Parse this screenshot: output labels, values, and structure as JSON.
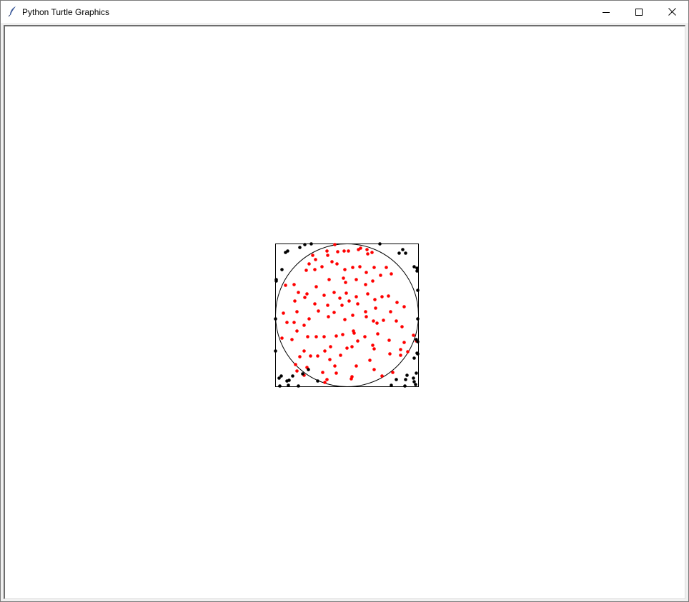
{
  "window": {
    "title": "Python Turtle Graphics",
    "icon": "feather-icon",
    "controls": {
      "minimize_icon": "minimize-icon",
      "maximize_icon": "maximize-icon",
      "close_icon": "close-icon"
    }
  },
  "colors": {
    "inside": "#ff0000",
    "outside": "#000000",
    "outline": "#000000",
    "background": "#ffffff"
  },
  "chart_data": {
    "type": "scatter",
    "xlim": [
      -1,
      1
    ],
    "ylim": [
      -1,
      1
    ],
    "square": {
      "xmin": -1,
      "xmax": 1,
      "ymin": -1,
      "ymax": 1
    },
    "circle": {
      "cx": 0,
      "cy": 0,
      "r": 1
    },
    "series": [
      {
        "color": "#ff0000",
        "points": [
          [
            -0.17,
            0.99
          ],
          [
            0.16,
            0.92
          ],
          [
            0.19,
            0.94
          ],
          [
            0.28,
            0.92
          ],
          [
            0.35,
            0.88
          ],
          [
            0.29,
            0.86
          ],
          [
            0.02,
            0.9
          ],
          [
            -0.04,
            0.9
          ],
          [
            -0.27,
            0.84
          ],
          [
            -0.48,
            0.84
          ],
          [
            -0.44,
            0.78
          ],
          [
            -0.28,
            0.9
          ],
          [
            -0.13,
            0.89
          ],
          [
            -0.21,
            0.75
          ],
          [
            -0.53,
            0.72
          ],
          [
            -0.57,
            0.63
          ],
          [
            -0.45,
            0.64
          ],
          [
            -0.35,
            0.68
          ],
          [
            -0.14,
            0.72
          ],
          [
            -0.03,
            0.64
          ],
          [
            0.08,
            0.67
          ],
          [
            0.18,
            0.68
          ],
          [
            0.27,
            0.6
          ],
          [
            0.38,
            0.67
          ],
          [
            0.55,
            0.67
          ],
          [
            0.62,
            0.58
          ],
          [
            0.47,
            0.56
          ],
          [
            0.36,
            0.48
          ],
          [
            0.26,
            0.43
          ],
          [
            0.13,
            0.5
          ],
          [
            -0.05,
            0.52
          ],
          [
            -0.25,
            0.5
          ],
          [
            -0.43,
            0.4
          ],
          [
            -0.74,
            0.43
          ],
          [
            -0.86,
            0.42
          ],
          [
            -0.68,
            0.32
          ],
          [
            -0.56,
            0.3
          ],
          [
            -0.32,
            0.28
          ],
          [
            -0.18,
            0.32
          ],
          [
            -0.1,
            0.24
          ],
          [
            -0.01,
            0.31
          ],
          [
            0.13,
            0.26
          ],
          [
            0.29,
            0.3
          ],
          [
            0.39,
            0.22
          ],
          [
            0.49,
            0.26
          ],
          [
            0.58,
            0.27
          ],
          [
            0.7,
            0.18
          ],
          [
            0.8,
            0.12
          ],
          [
            0.61,
            0.05
          ],
          [
            0.4,
            0.1
          ],
          [
            0.26,
            0.05
          ],
          [
            0.15,
            0.16
          ],
          [
            0.03,
            0.2
          ],
          [
            -0.07,
            0.14
          ],
          [
            -0.27,
            0.14
          ],
          [
            -0.45,
            0.16
          ],
          [
            -0.59,
            0.25
          ],
          [
            -0.73,
            0.2
          ],
          [
            -0.7,
            0.05
          ],
          [
            -0.89,
            0.03
          ],
          [
            -0.84,
            -0.1
          ],
          [
            -0.74,
            -0.1
          ],
          [
            -0.6,
            -0.14
          ],
          [
            -0.53,
            -0.05
          ],
          [
            -0.4,
            0.06
          ],
          [
            -0.26,
            -0.02
          ],
          [
            -0.18,
            0.04
          ],
          [
            -0.03,
            -0.06
          ],
          [
            0.08,
            0.0
          ],
          [
            0.27,
            -0.02
          ],
          [
            0.37,
            -0.08
          ],
          [
            0.51,
            -0.07
          ],
          [
            0.69,
            -0.08
          ],
          [
            0.77,
            -0.16
          ],
          [
            0.93,
            -0.28
          ],
          [
            0.97,
            -0.36
          ],
          [
            0.8,
            -0.38
          ],
          [
            0.75,
            -0.48
          ],
          [
            0.59,
            -0.35
          ],
          [
            0.43,
            -0.26
          ],
          [
            0.36,
            -0.42
          ],
          [
            0.25,
            -0.3
          ],
          [
            0.1,
            -0.25
          ],
          [
            -0.06,
            -0.27
          ],
          [
            -0.15,
            -0.29
          ],
          [
            -0.32,
            -0.3
          ],
          [
            -0.43,
            -0.3
          ],
          [
            -0.55,
            -0.3
          ],
          [
            -0.7,
            -0.22
          ],
          [
            -0.77,
            -0.34
          ],
          [
            -0.91,
            -0.32
          ],
          [
            -0.6,
            -0.5
          ],
          [
            -0.51,
            -0.57
          ],
          [
            -0.66,
            -0.58
          ],
          [
            -0.72,
            -0.69
          ],
          [
            -0.41,
            -0.57
          ],
          [
            -0.31,
            -0.5
          ],
          [
            -0.24,
            -0.62
          ],
          [
            -0.09,
            -0.56
          ],
          [
            0.0,
            -0.46
          ],
          [
            0.07,
            -0.44
          ],
          [
            0.15,
            -0.36
          ],
          [
            0.09,
            -0.22
          ],
          [
            0.38,
            -0.47
          ],
          [
            0.6,
            -0.54
          ],
          [
            0.75,
            -0.56
          ],
          [
            0.85,
            -0.51
          ],
          [
            0.64,
            -0.8
          ],
          [
            0.49,
            -0.85
          ],
          [
            0.38,
            -0.76
          ],
          [
            0.13,
            -0.71
          ],
          [
            0.07,
            -0.86
          ],
          [
            0.06,
            -0.89
          ],
          [
            -0.15,
            -0.81
          ],
          [
            -0.34,
            -0.8
          ],
          [
            -0.28,
            -0.9
          ],
          [
            -0.31,
            -0.94
          ],
          [
            -0.6,
            -0.84
          ],
          [
            -0.7,
            -0.78
          ],
          [
            -0.56,
            -0.73
          ],
          [
            -0.17,
            -0.71
          ],
          [
            0.32,
            -0.63
          ],
          [
            -0.23,
            -0.44
          ],
          [
            0.42,
            -0.11
          ],
          [
            -0.02,
            0.46
          ]
        ]
      },
      {
        "color": "#000000",
        "points": [
          [
            -0.66,
            0.95
          ],
          [
            -0.59,
            0.99
          ],
          [
            -0.5,
            1.0
          ],
          [
            -0.83,
            0.9
          ],
          [
            -0.86,
            0.88
          ],
          [
            -0.99,
            0.5
          ],
          [
            -0.99,
            0.48
          ],
          [
            -1.0,
            -0.05
          ],
          [
            -0.91,
            0.64
          ],
          [
            -1.0,
            -0.5
          ],
          [
            -0.95,
            -0.88
          ],
          [
            -0.92,
            -0.85
          ],
          [
            -0.84,
            -0.92
          ],
          [
            -0.81,
            -0.91
          ],
          [
            -0.76,
            -0.85
          ],
          [
            -0.62,
            -0.82
          ],
          [
            -0.54,
            -0.76
          ],
          [
            -0.41,
            -0.92
          ],
          [
            -0.68,
            -0.99
          ],
          [
            -0.94,
            -0.99
          ],
          [
            -0.82,
            -0.98
          ],
          [
            0.46,
            1.0
          ],
          [
            0.73,
            0.87
          ],
          [
            0.82,
            0.87
          ],
          [
            0.78,
            0.92
          ],
          [
            0.94,
            0.68
          ],
          [
            0.98,
            0.66
          ],
          [
            0.98,
            0.62
          ],
          [
            0.99,
            0.35
          ],
          [
            0.99,
            -0.05
          ],
          [
            0.97,
            -0.34
          ],
          [
            0.99,
            -0.37
          ],
          [
            0.94,
            -0.6
          ],
          [
            0.98,
            -0.53
          ],
          [
            0.99,
            -0.54
          ],
          [
            0.84,
            -0.84
          ],
          [
            0.82,
            -0.9
          ],
          [
            0.93,
            -0.88
          ],
          [
            0.96,
            -0.97
          ],
          [
            0.81,
            -0.99
          ],
          [
            0.62,
            -0.98
          ],
          [
            0.69,
            -0.9
          ],
          [
            0.94,
            -0.93
          ],
          [
            0.97,
            -0.81
          ]
        ]
      }
    ]
  }
}
